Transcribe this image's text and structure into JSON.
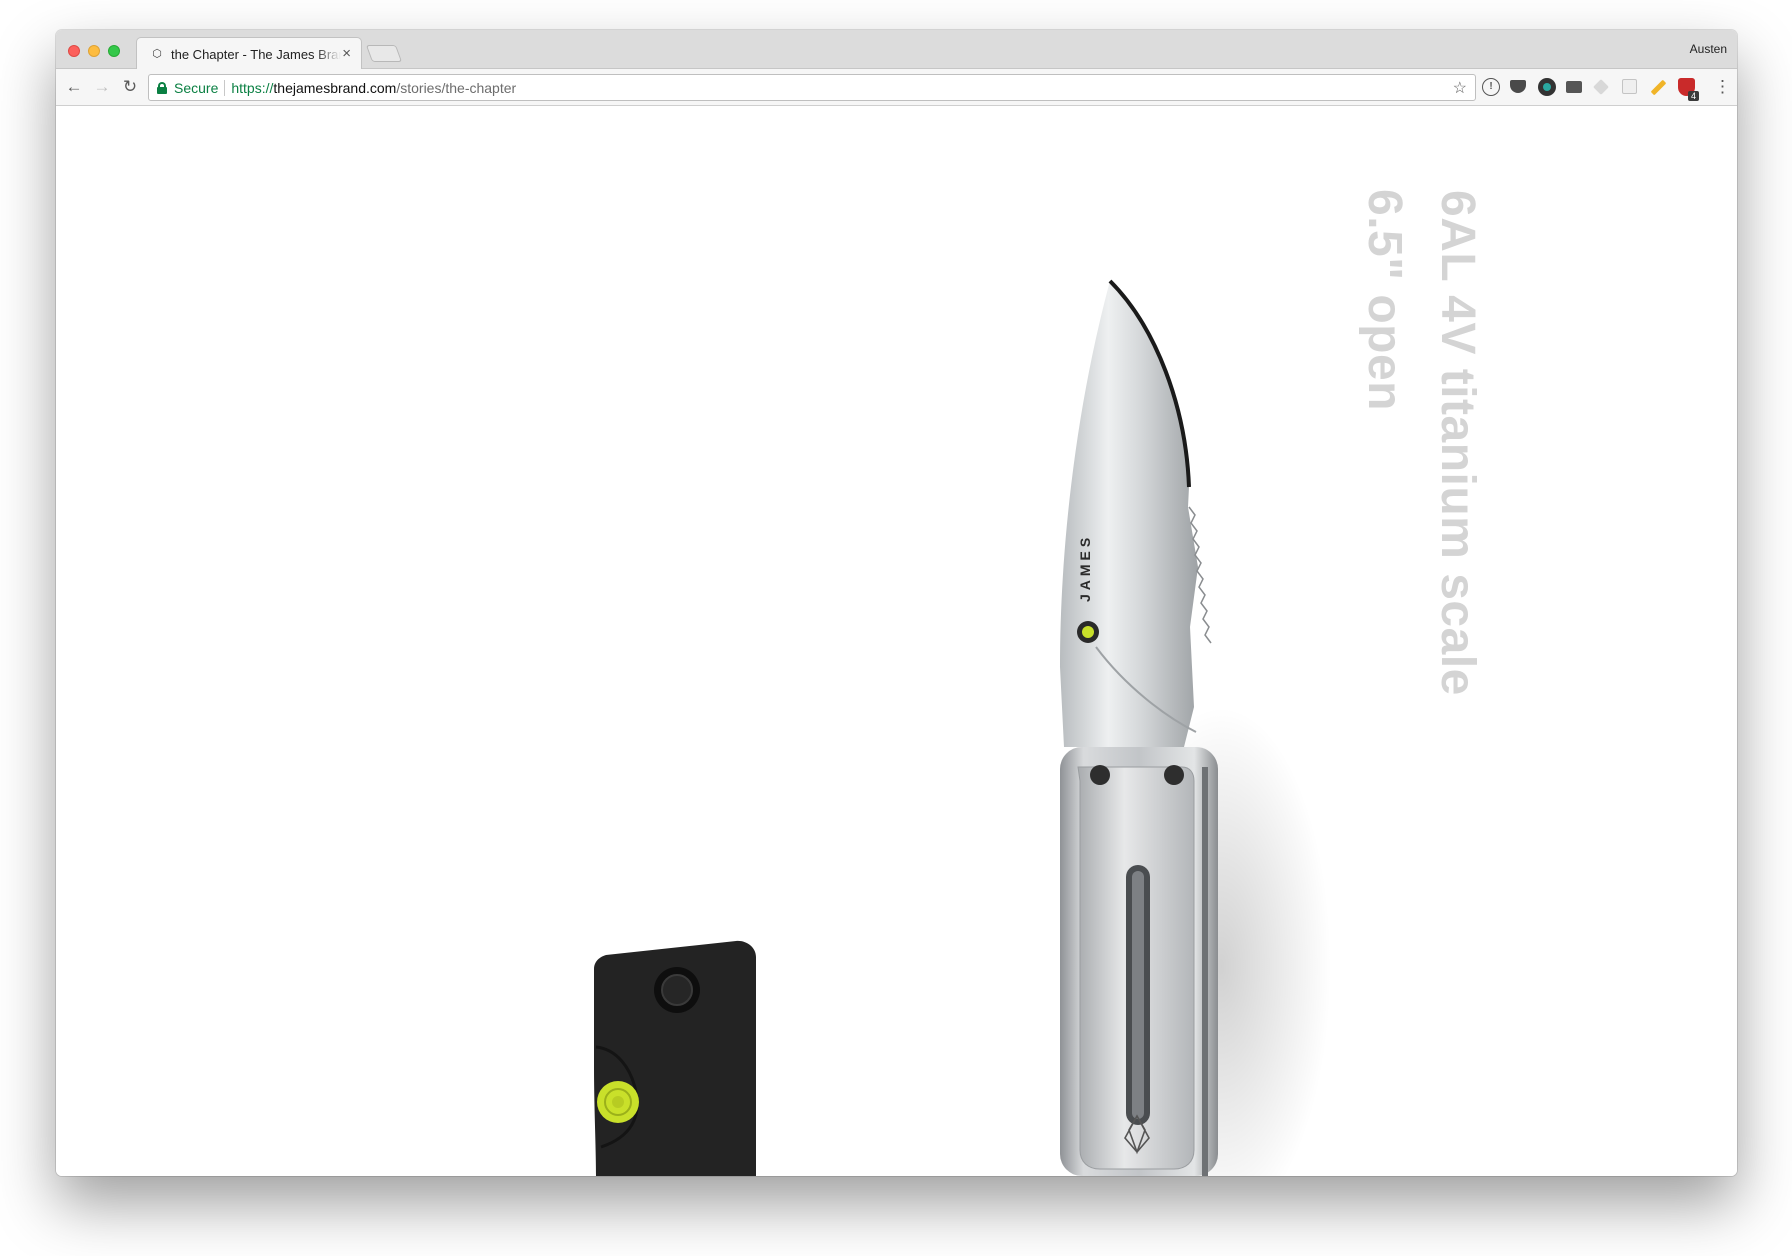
{
  "browser": {
    "tab_title": "the Chapter - The James Brand",
    "tab_close": "×",
    "profile_name": "Austen",
    "back_icon": "←",
    "forward_icon": "→",
    "reload_icon": "↻",
    "secure_label": "Secure",
    "url_scheme": "https://",
    "url_host": "thejamesbrand.com",
    "url_path": "/stories/the-chapter",
    "star_icon": "☆",
    "menu_icon": "⋮",
    "extensions": [
      "info-icon",
      "pocket-icon",
      "circle-extension-icon",
      "mail-icon",
      "dropbox-icon",
      "square-extension-icon",
      "pencil-icon",
      "shield-extension-icon"
    ],
    "extension_badge": "4"
  },
  "page": {
    "spec_material": "6AL 4V titanium scale",
    "spec_length": "6.5\" open",
    "blade_brand": "JAMES",
    "spec_color": "#d4d4d4",
    "accent_color": "#c9e02a"
  }
}
